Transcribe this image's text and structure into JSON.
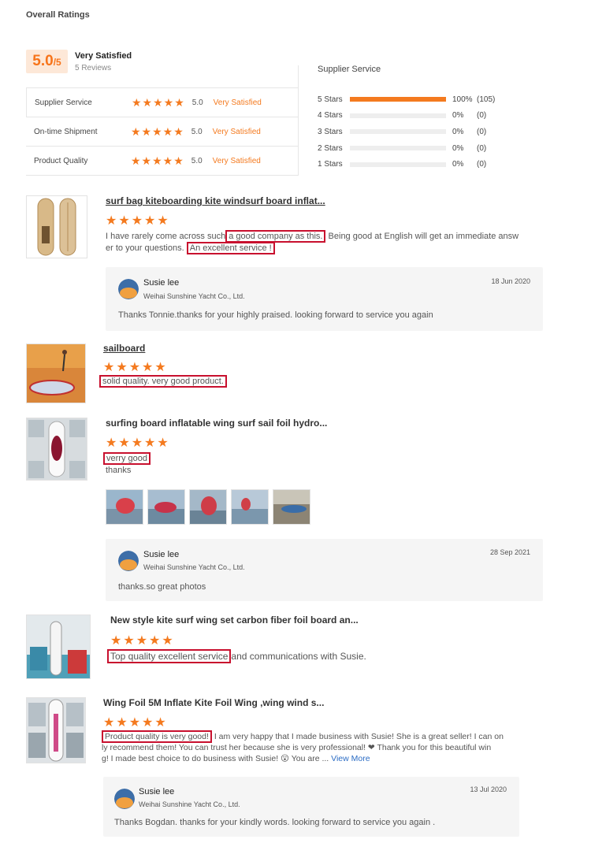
{
  "header": {
    "title": "Overall Ratings"
  },
  "overall": {
    "score": "5.0",
    "outof": "/5",
    "label": "Very Satisfied",
    "reviews": "5 Reviews"
  },
  "ratings": [
    {
      "name": "Supplier Service",
      "stars": "★★★★★",
      "value": "5.0",
      "desc": "Very Satisfied"
    },
    {
      "name": "On-time Shipment",
      "stars": "★★★★★",
      "value": "5.0",
      "desc": "Very Satisfied"
    },
    {
      "name": "Product Quality",
      "stars": "★★★★★",
      "value": "5.0",
      "desc": "Very Satisfied"
    }
  ],
  "supplier_service": {
    "title": "Supplier Service",
    "rows": [
      {
        "label": "5 Stars",
        "pct": "100%",
        "count": "(105)",
        "fill": 1.0
      },
      {
        "label": "4 Stars",
        "pct": "0%",
        "count": "(0)",
        "fill": 0
      },
      {
        "label": "3 Stars",
        "pct": "0%",
        "count": "(0)",
        "fill": 0
      },
      {
        "label": "2 Stars",
        "pct": "0%",
        "count": "(0)",
        "fill": 0
      },
      {
        "label": "1 Stars",
        "pct": "0%",
        "count": "(0)",
        "fill": 0
      }
    ]
  },
  "reviews": [
    {
      "title": "surf bag kiteboarding kite windsurf board inflat...",
      "stars": "★★★★★",
      "text_pre": "I have rarely come across such",
      "text_hl1": "a good company as this.",
      "text_mid": " Being good at English will get an immediate answ",
      "text_line2": "er to your questions.",
      "text_hl2": "An excellent service !",
      "reply": {
        "name": "Susie lee",
        "company": "Weihai Sunshine Yacht Co., Ltd.",
        "date": "18 Jun 2020",
        "message": "Thanks Tonnie.thanks for your highly praised. looking forward to service you again"
      }
    },
    {
      "title": "sailboard",
      "stars": "★★★★★",
      "text_hl1": "solid quality. very good product."
    },
    {
      "title": "surfing board inflatable wing surf sail foil hydro...",
      "stars": "★★★★★",
      "text_hl1": "verry good",
      "text_line2": "thanks",
      "reply": {
        "name": "Susie lee",
        "company": "Weihai Sunshine Yacht Co., Ltd.",
        "date": "28 Sep 2021",
        "message": "thanks.so great photos"
      }
    },
    {
      "title": "New style kite surf wing set carbon fiber foil board an...",
      "stars": "★★★★★",
      "text_hl1": "Top quality excellent service",
      "text_post": "and communications with Susie."
    },
    {
      "title": "Wing Foil 5M Inflate Kite Foil Wing ,wing wind s...",
      "stars": "★★★★★",
      "text_hl1": "Product quality is very good!",
      "text_post": " I am very happy that I made business with Susie! She is a great seller! I can on",
      "text_line2": "ly recommend them! You can trust her because she is very professional! ❤ Thank you for this beautiful win",
      "text_line3": "g! I made best choice to do business with Susie! 😮 You are ...",
      "view_more": "View More",
      "reply": {
        "name": "Susie lee",
        "company": "Weihai Sunshine Yacht Co., Ltd.",
        "date": "13 Jul 2020",
        "message": "Thanks Bogdan. thanks for your kindly words. looking forward to service you again ."
      }
    }
  ]
}
